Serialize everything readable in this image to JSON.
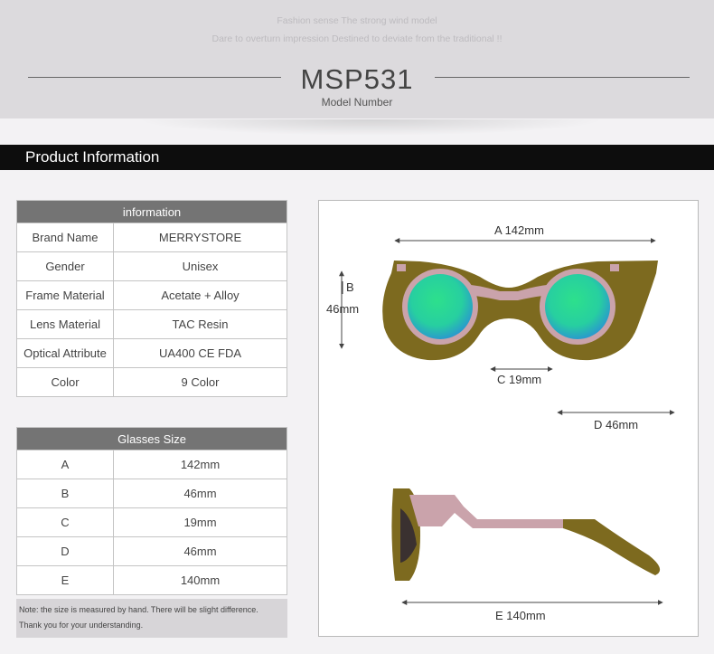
{
  "header": {
    "slogan_line1": "Fashion sense The strong wind model",
    "slogan_line2": "Dare to overturn impression Destined to deviate from the traditional !!",
    "model_number": "MSP531",
    "model_caption": "Model Number"
  },
  "section": {
    "title": "Product Information"
  },
  "info_table": {
    "header": "information",
    "rows": [
      {
        "label": "Brand Name",
        "value": "MERRYSTORE"
      },
      {
        "label": "Gender",
        "value": "Unisex"
      },
      {
        "label": "Frame Material",
        "value": "Acetate + Alloy"
      },
      {
        "label": "Lens Material",
        "value": "TAC Resin"
      },
      {
        "label": "Optical Attribute",
        "value": "UA400 CE FDA"
      },
      {
        "label": "Color",
        "value": "9 Color"
      }
    ]
  },
  "size_table": {
    "header": "Glasses Size",
    "rows": [
      {
        "label": "A",
        "value": "142mm"
      },
      {
        "label": "B",
        "value": "46mm"
      },
      {
        "label": "C",
        "value": "19mm"
      },
      {
        "label": "D",
        "value": "46mm"
      },
      {
        "label": "E",
        "value": "140mm"
      }
    ]
  },
  "note": {
    "line1": "Note: the size is measured by hand. There will be slight difference.",
    "line2": "Thank you for your understanding."
  },
  "diagram": {
    "dim_a": "A 142mm",
    "dim_b_letter": "B",
    "dim_b_value": "46mm",
    "dim_c": "C 19mm",
    "dim_d": "D 46mm",
    "dim_e": "E 140mm"
  },
  "colors": {
    "frame_olive": "#7d6a1f",
    "frame_pink": "#caa3ab",
    "lens_green": "#27d996",
    "lens_blue": "#2aa6d8",
    "section_bar": "#0d0d0d",
    "table_header": "#747474"
  }
}
